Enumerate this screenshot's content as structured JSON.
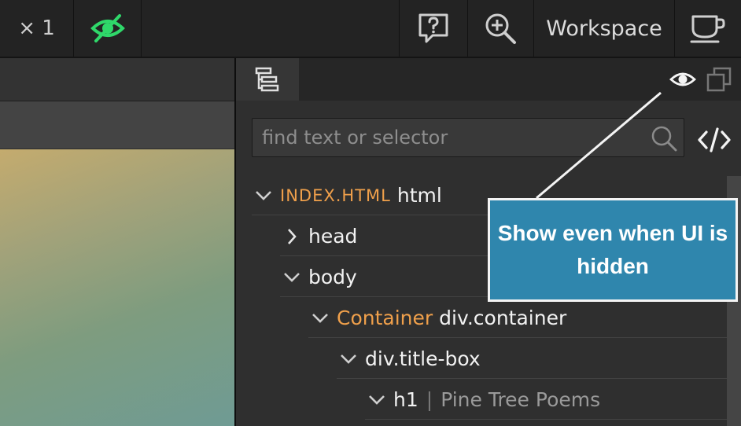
{
  "toolbar": {
    "zoom_label": "× 1",
    "workspace_label": "Workspace",
    "icons": {
      "visibility": "eye-slash-icon",
      "help": "help-bubble-icon",
      "zoom": "zoom-in-icon",
      "coffee": "coffee-cup-icon"
    },
    "accent": "#2fd86a"
  },
  "panel": {
    "tabs": {
      "tree_icon": "tree-structure-icon",
      "eye_icon": "eye-icon",
      "copy_icon": "duplicate-icon"
    },
    "search": {
      "placeholder": "find text or selector",
      "value": ""
    },
    "code_toggle_icon": "code-tags-icon"
  },
  "tree": {
    "rows": [
      {
        "name_tag": "INDEX.HTML",
        "selector": "html",
        "expanded": true
      },
      {
        "selector": "head",
        "expanded": false
      },
      {
        "selector": "body",
        "expanded": true
      },
      {
        "name_tag": "Container",
        "selector": "div.container",
        "expanded": true
      },
      {
        "selector": "div.title-box",
        "expanded": true
      },
      {
        "selector": "h1",
        "separator": "|",
        "text": "Pine Tree Poems",
        "expanded": true
      }
    ]
  },
  "callout": {
    "text": "Show even when UI is hidden"
  },
  "colors": {
    "orange": "#f0a04b",
    "callout_bg": "#2f86ad"
  }
}
